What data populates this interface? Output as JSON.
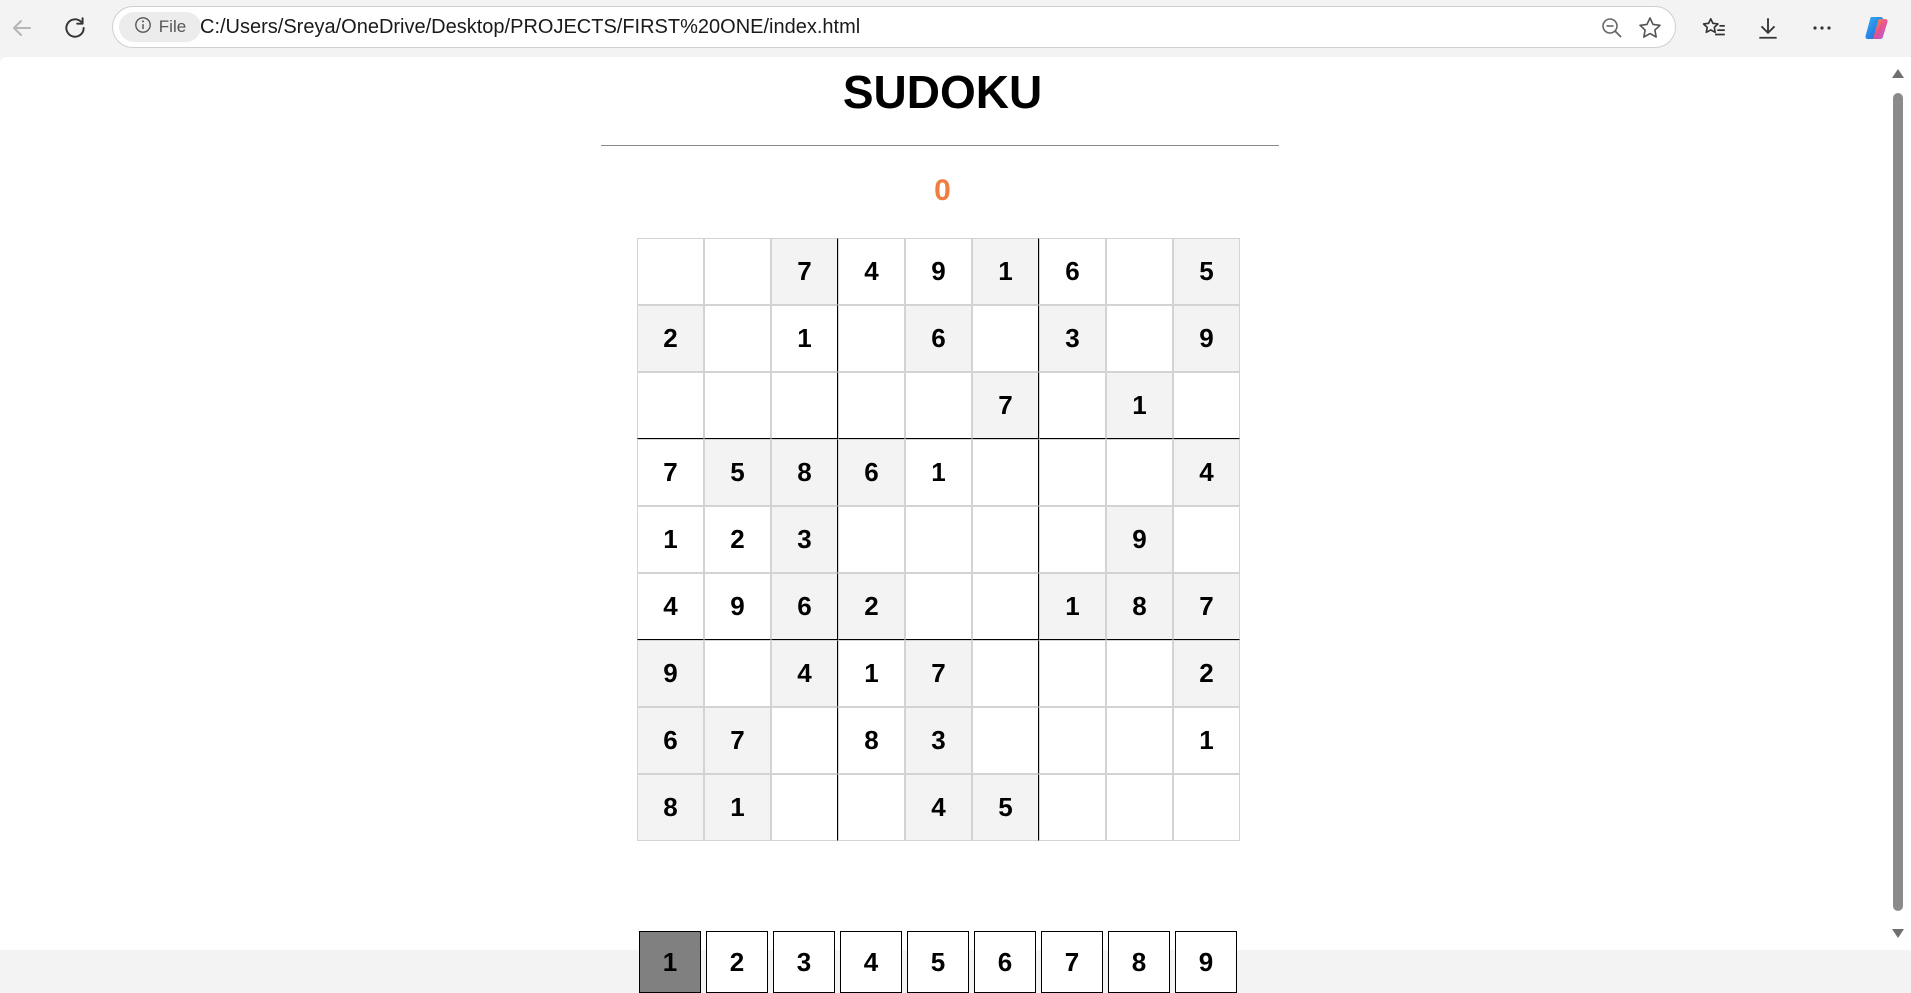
{
  "browser": {
    "site_info_label": "File",
    "url": "C:/Users/Sreya/OneDrive/Desktop/PROJECTS/FIRST%20ONE/index.html",
    "icons": [
      "back-arrow-icon",
      "refresh-icon",
      "info-icon",
      "zoom-out-icon",
      "favorite-star-icon",
      "favorites-list-icon",
      "download-icon",
      "more-options-icon",
      "copilot-icon"
    ]
  },
  "page": {
    "title": "SUDOKU",
    "error_count": "0",
    "accent_color": "#f07c42"
  },
  "board": {
    "rows": [
      [
        "",
        "",
        "7",
        "4",
        "9",
        "1",
        "6",
        "",
        "5"
      ],
      [
        "2",
        "",
        "1",
        "",
        "6",
        "",
        "3",
        "",
        "9"
      ],
      [
        "",
        "",
        "",
        "",
        "",
        "7",
        "",
        "1",
        ""
      ],
      [
        "7",
        "5",
        "8",
        "6",
        "1",
        "",
        "",
        "",
        "4"
      ],
      [
        "1",
        "2",
        "3",
        "",
        "",
        "",
        "",
        "9",
        ""
      ],
      [
        "4",
        "9",
        "6",
        "2",
        "",
        "",
        "1",
        "8",
        "7"
      ],
      [
        "9",
        "",
        "4",
        "1",
        "7",
        "",
        "",
        "",
        "2"
      ],
      [
        "6",
        "7",
        "",
        "8",
        "3",
        "",
        "",
        "",
        "1"
      ],
      [
        "8",
        "1",
        "",
        "",
        "4",
        "5",
        "",
        "",
        ""
      ]
    ],
    "shaded": [
      [
        false,
        false,
        true,
        false,
        false,
        true,
        false,
        false,
        true
      ],
      [
        true,
        false,
        false,
        false,
        true,
        false,
        true,
        false,
        true
      ],
      [
        false,
        false,
        false,
        false,
        false,
        true,
        false,
        true,
        false
      ],
      [
        false,
        true,
        true,
        true,
        false,
        false,
        false,
        false,
        true
      ],
      [
        false,
        false,
        true,
        false,
        false,
        false,
        false,
        true,
        false
      ],
      [
        false,
        false,
        true,
        true,
        false,
        false,
        true,
        true,
        true
      ],
      [
        true,
        false,
        true,
        false,
        true,
        false,
        false,
        false,
        true
      ],
      [
        true,
        true,
        false,
        false,
        true,
        false,
        false,
        false,
        false
      ],
      [
        true,
        true,
        false,
        false,
        true,
        true,
        false,
        false,
        false
      ]
    ]
  },
  "digits": {
    "values": [
      "1",
      "2",
      "3",
      "4",
      "5",
      "6",
      "7",
      "8",
      "9"
    ],
    "selected": "1"
  }
}
